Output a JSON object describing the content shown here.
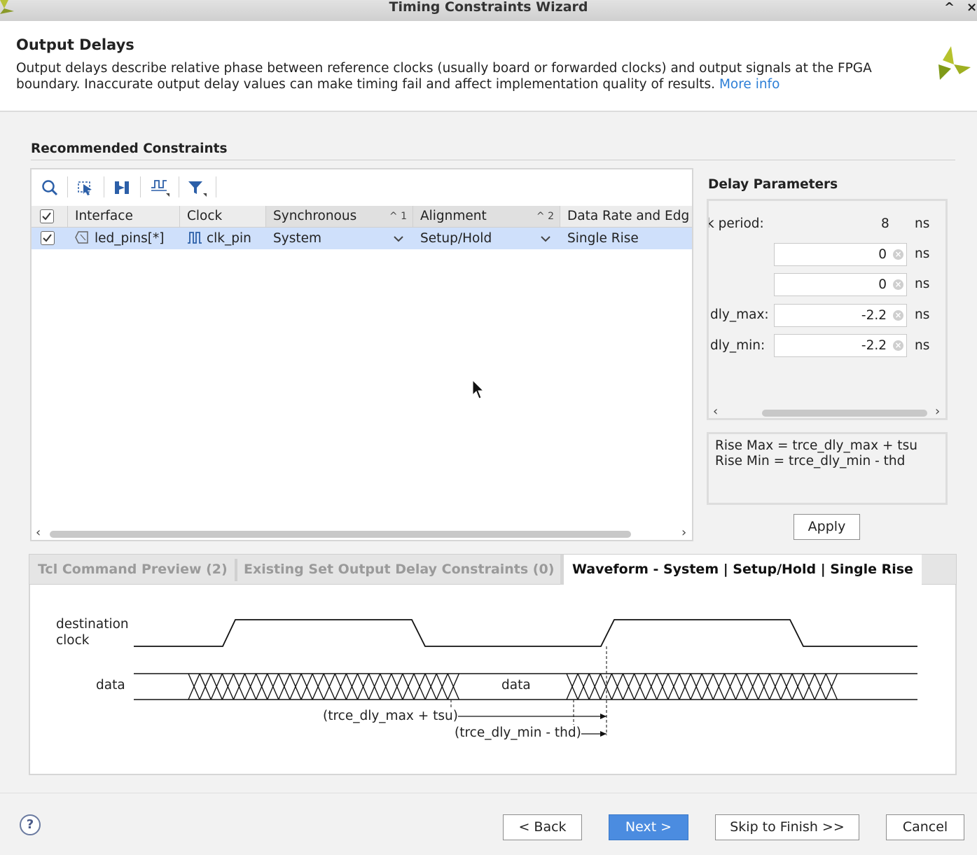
{
  "window": {
    "title": "Timing Constraints Wizard",
    "collapse_glyph": "^",
    "close_glyph": "×"
  },
  "header": {
    "title": "Output Delays",
    "description": "Output delays describe relative phase between reference clocks (usually board or forwarded clocks) and output signals at the FPGA boundary. Inaccurate output delay values can make timing fail and affect implementation quality of results.",
    "more_info": "More info"
  },
  "recommended": {
    "title": "Recommended Constraints",
    "columns": [
      {
        "label": "Interface"
      },
      {
        "label": "Clock"
      },
      {
        "label": "Synchronous",
        "sort": "1"
      },
      {
        "label": "Alignment",
        "sort": "2"
      },
      {
        "label": "Data Rate and Edg"
      }
    ],
    "rows": [
      {
        "checked": true,
        "interface": "led_pins[*]",
        "clock": "clk_pin",
        "synchronous": "System",
        "alignment": "Setup/Hold",
        "data_rate": "Single Rise"
      }
    ],
    "toolbar_icons": [
      "search-icon",
      "select-icon",
      "expand-icon",
      "waveform-icon",
      "filter-icon"
    ]
  },
  "delay_parameters": {
    "title": "Delay Parameters",
    "period_label": "k period:",
    "period_value": "8",
    "unit": "ns",
    "fields": [
      {
        "label": "",
        "value": "0"
      },
      {
        "label": "",
        "value": "0"
      },
      {
        "label": "dly_max:",
        "value": "-2.2"
      },
      {
        "label": "dly_min:",
        "value": "-2.2"
      }
    ],
    "formula_line1": "Rise Max = trce_dly_max + tsu",
    "formula_line2": "Rise Min = trce_dly_min - thd",
    "apply": "Apply"
  },
  "tabs": [
    {
      "label": "Tcl Command Preview (2)",
      "active": false
    },
    {
      "label": "Existing Set Output Delay Constraints (0)",
      "active": false
    },
    {
      "label": "Waveform - System | Setup/Hold | Single Rise",
      "active": true
    }
  ],
  "waveform": {
    "clock_label_1": "destination",
    "clock_label_2": "clock",
    "data_label": "data",
    "data_center_label": "data",
    "annotation_max": "(trce_dly_max + tsu)",
    "annotation_min": "(trce_dly_min - thd)"
  },
  "footer": {
    "help": "?",
    "back": "< Back",
    "next": "Next >",
    "skip": "Skip to Finish >>",
    "cancel": "Cancel"
  }
}
